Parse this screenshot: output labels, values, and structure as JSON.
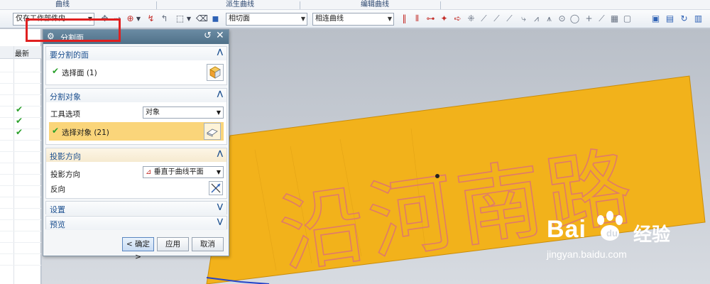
{
  "ribbon": {
    "groups": [
      "曲线",
      "派生曲线",
      "编辑曲线"
    ]
  },
  "toolbar": {
    "filter_combo": "仅在工作部件内",
    "face_rule_combo": "相切面",
    "curve_rule_combo": "相连曲线"
  },
  "navigator": {
    "column_header": "最新"
  },
  "dialog": {
    "title": "分割面",
    "section_face": {
      "header": "要分割的面",
      "select_label": "选择面 (1)"
    },
    "section_object": {
      "header": "分割对象",
      "tool_option_label": "工具选项",
      "tool_option_value": "对象",
      "select_label": "选择对象 (21)"
    },
    "section_projection": {
      "header": "投影方向",
      "direction_label": "投影方向",
      "direction_value": "垂直于曲线平面",
      "reverse_label": "反向"
    },
    "section_settings": {
      "header": "设置"
    },
    "section_preview": {
      "header": "预览"
    },
    "buttons": {
      "ok": "< 确定 >",
      "apply": "应用",
      "cancel": "取消"
    }
  },
  "viewport": {
    "model_text": "沿河南路",
    "plate_color": "#f2b21b",
    "outline_color": "#e07a6a"
  },
  "watermark": {
    "brand": "Bai",
    "brand_suffix": "经验",
    "url": "jingyan.baidu.com"
  },
  "colors": {
    "title_bar": "#507189",
    "highlight": "#e02020",
    "selected_row": "#fad57a",
    "check": "#2aa02a"
  }
}
